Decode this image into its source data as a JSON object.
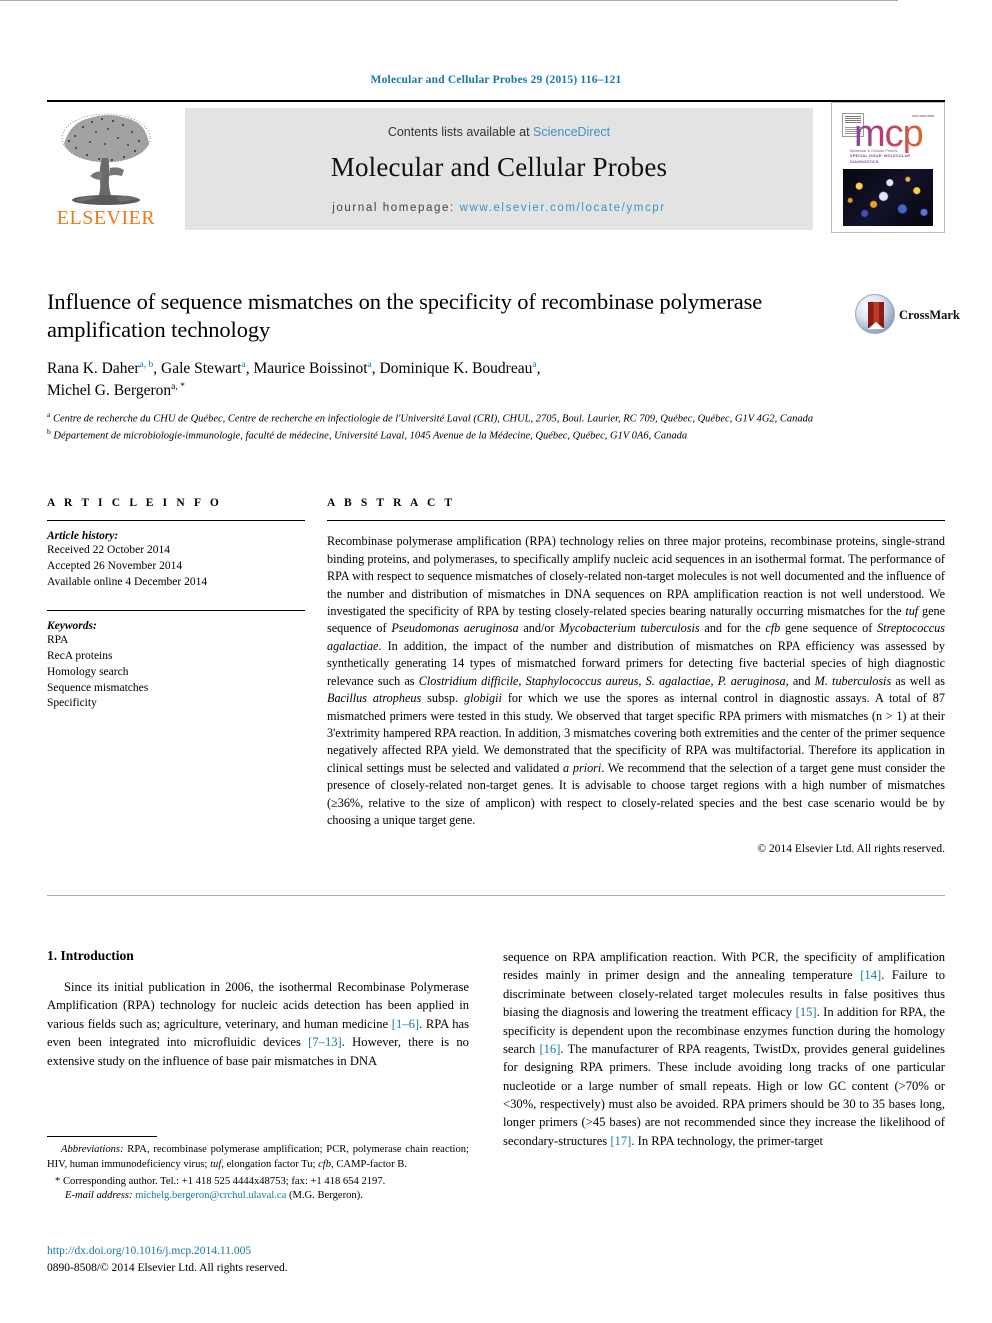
{
  "running_head": "Molecular and Cellular Probes 29 (2015) 116–121",
  "banner": {
    "publisher_name": "ELSEVIER",
    "publisher_logo_icon": "elsevier-tree-icon",
    "contents_prefix": "Contents lists available at",
    "contents_link": "ScienceDirect",
    "journal_title": "Molecular and Cellular Probes",
    "homepage_prefix": "journal homepage:",
    "homepage_url": "www.elsevier.com/locate/ymcpr",
    "cover": {
      "logo_text": "mcp",
      "subtitle_line1": "Molecular & Cellular Probes",
      "subtitle_line2": "SPECIAL ISSUE: MOLECULAR DIAGNOSTICS",
      "issn": "ISSN 0890-8508"
    }
  },
  "article": {
    "title": "Influence of sequence mismatches on the specificity of recombinase polymerase amplification technology",
    "authors_line1_a": "Rana K. Daher",
    "authors_line1_a_sup": "a, b",
    "authors_line1_b": ", Gale Stewart",
    "authors_line1_b_sup": "a",
    "authors_line1_c": ", Maurice Boissinot",
    "authors_line1_c_sup": "a",
    "authors_line1_d": ", Dominique K. Boudreau",
    "authors_line1_d_sup": "a",
    "authors_line1_end": ",",
    "authors_line2": "Michel G. Bergeron",
    "authors_line2_sup": "a, *",
    "crossmark_label": "CrossMark",
    "affiliation_a_sup": "a",
    "affiliation_a": "Centre de recherche du CHU de Québec, Centre de recherche en infectiologie de l'Université Laval (CRI), CHUL, 2705, Boul. Laurier, RC 709, Québec, Québec, G1V 4G2, Canada",
    "affiliation_b_sup": "b",
    "affiliation_b": "Département de microbiologie-immunologie, faculté de médecine, Université Laval, 1045 Avenue de la Médecine, Québec, Québec, G1V 0A6, Canada"
  },
  "article_info": {
    "heading": "A R T I C L E  I N F O",
    "history_label": "Article history:",
    "received": "Received 22 October 2014",
    "accepted": "Accepted 26 November 2014",
    "available": "Available online 4 December 2014",
    "keywords_label": "Keywords:",
    "keywords": [
      "RPA",
      "RecA proteins",
      "Homology search",
      "Sequence mismatches",
      "Specificity"
    ]
  },
  "abstract": {
    "heading": "A B S T R A C T",
    "copyright": "© 2014 Elsevier Ltd. All rights reserved."
  },
  "introduction": {
    "heading": "1. Introduction"
  },
  "footnotes": {
    "abbreviations_label": "Abbreviations:",
    "corresponding_marker": "*",
    "corresponding": "Corresponding author. Tel.: +1 418 525 4444x48753; fax: +1 418 654 2197.",
    "email_label": "E-mail address:",
    "email": "michelg.bergeron@crchul.ulaval.ca",
    "email_suffix": "(M.G. Bergeron)."
  },
  "bottom": {
    "doi": "http://dx.doi.org/10.1016/j.mcp.2014.11.005",
    "issn_line": "0890-8508/© 2014 Elsevier Ltd. All rights reserved."
  },
  "colors": {
    "link_blue": "#1579a8",
    "science_direct_blue": "#3e92c8",
    "elsevier_orange": "#e87b1e"
  }
}
